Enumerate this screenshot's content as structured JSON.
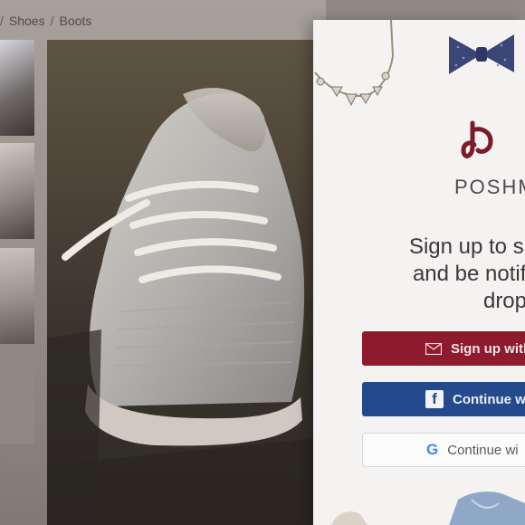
{
  "breadcrumb": {
    "separator": "/",
    "items": [
      "Shoes",
      "Boots"
    ]
  },
  "gallery": {
    "thumbnail_count": 4,
    "main_image": "sneaker-photo"
  },
  "modal": {
    "brand": "POSHM",
    "headline_lines": [
      "Sign up to sav",
      "and be notifie",
      "drop"
    ],
    "buttons": {
      "email": "Sign up with",
      "facebook": "Continue wi",
      "google": "Continue wi"
    },
    "colors": {
      "email_button": "#8e1a2d",
      "facebook_button": "#244a8d",
      "brand_mark": "#7a1c2a"
    }
  }
}
